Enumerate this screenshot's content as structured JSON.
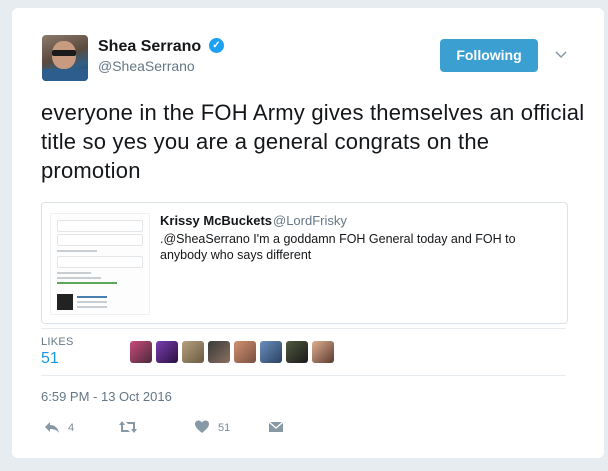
{
  "tweet": {
    "author_name": "Shea Serrano",
    "author_handle": "@SheaSerrano",
    "verified": true,
    "follow_button_label": "Following",
    "text": "everyone in the FOH Army gives themselves an official title so yes you are a general congrats on the promotion",
    "timestamp": "6:59 PM - 13 Oct 2016"
  },
  "quoted_tweet": {
    "author_name": "Krissy McBuckets",
    "author_handle": "@LordFrisky",
    "text": ".@SheaSerrano I'm a goddamn FOH General today and FOH to anybody who says different"
  },
  "stats": {
    "likes_label": "LIKES",
    "likes_count": "51"
  },
  "actions": {
    "reply_count": "4",
    "retweet_count": "",
    "like_count": "51"
  },
  "icons": {
    "verified": "verified-badge-icon",
    "chevron": "chevron-down-icon",
    "reply": "reply-icon",
    "retweet": "retweet-icon",
    "like": "heart-icon",
    "dm": "direct-message-icon"
  },
  "colors": {
    "accent": "#1da1f2",
    "follow_button": "#3b9fd2",
    "likes_count": "#1b95e0",
    "muted": "#657786"
  }
}
